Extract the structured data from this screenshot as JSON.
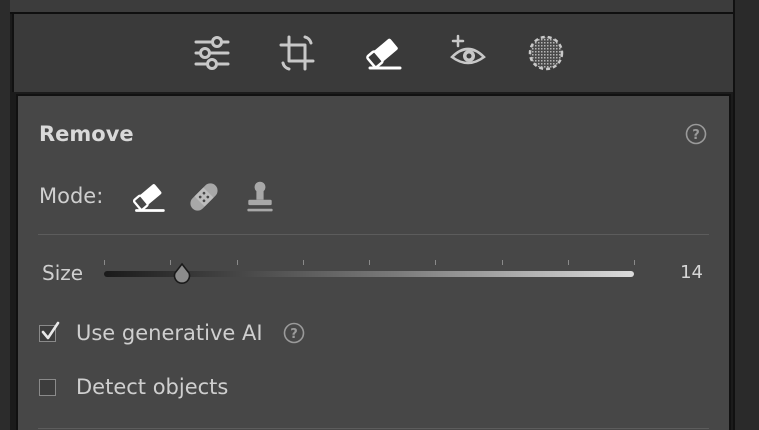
{
  "toolbar": {
    "tools": [
      {
        "icon": "sliders-icon",
        "active": false
      },
      {
        "icon": "crop-icon",
        "active": false
      },
      {
        "icon": "eraser-icon",
        "active": true
      },
      {
        "icon": "redeye-icon",
        "active": false
      },
      {
        "icon": "mask-icon",
        "active": false
      }
    ]
  },
  "panel": {
    "title": "Remove",
    "mode_label": "Mode:",
    "modes": [
      "eraser-icon",
      "bandage-icon",
      "stamp-icon"
    ],
    "size": {
      "label": "Size",
      "value": "14",
      "fraction": 0.148
    },
    "options": [
      {
        "label": "Use generative AI",
        "checked": true
      },
      {
        "label": "Detect objects",
        "checked": false
      }
    ]
  },
  "colors": {
    "panel_bg": "#474747",
    "toolbar_bg": "#3a3a3a",
    "text": "#cfcfcf"
  }
}
